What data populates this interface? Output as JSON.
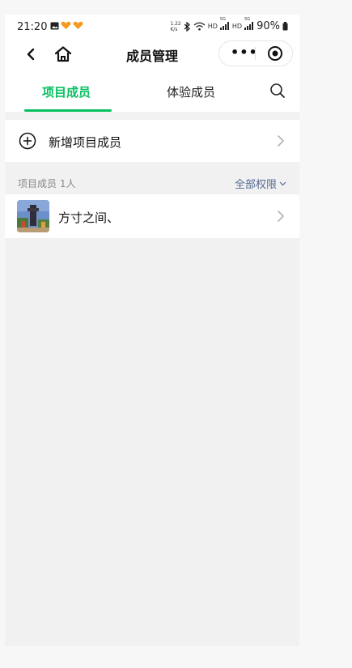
{
  "status_bar": {
    "time": "21:20",
    "net_speed_top": "1.22",
    "net_speed_bottom": "K/s",
    "signal1_label": "HD",
    "signal1_tag": "5G",
    "signal2_label": "HD",
    "signal2_tag": "5G",
    "battery": "90%"
  },
  "nav": {
    "title": "成员管理",
    "more_glyph": "•••"
  },
  "tabs": {
    "active": "项目成员",
    "inactive": "体验成员"
  },
  "add_row": {
    "label": "新增项目成员"
  },
  "section": {
    "title": "项目成员 1人",
    "filter": "全部权限"
  },
  "members": [
    {
      "name": "方寸之间、"
    }
  ],
  "colors": {
    "accent": "#07c160",
    "link": "#576b95",
    "background": "#f1f1f1"
  }
}
